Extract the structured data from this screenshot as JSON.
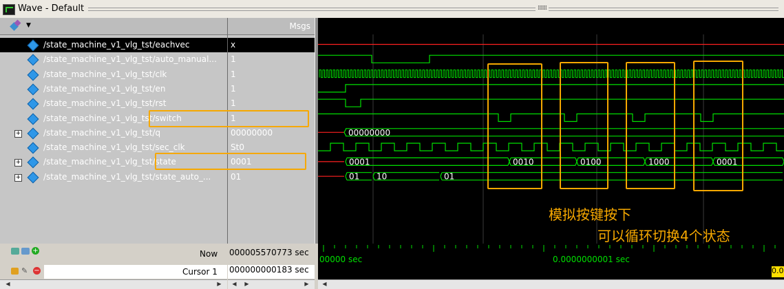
{
  "window": {
    "title": "Wave - Default"
  },
  "columns": {
    "msgs": "Msgs"
  },
  "signals": [
    {
      "name": "/state_machine_v1_vlg_tst/eachvec",
      "value": "x",
      "expandable": false
    },
    {
      "name": "/state_machine_v1_vlg_tst/auto_manual...",
      "value": "1",
      "expandable": false
    },
    {
      "name": "/state_machine_v1_vlg_tst/clk",
      "value": "1",
      "expandable": false
    },
    {
      "name": "/state_machine_v1_vlg_tst/en",
      "value": "1",
      "expandable": false
    },
    {
      "name": "/state_machine_v1_vlg_tst/rst",
      "value": "1",
      "expandable": false
    },
    {
      "name": "/state_machine_v1_vlg_tst/switch",
      "value": "1",
      "expandable": false
    },
    {
      "name": "/state_machine_v1_vlg_tst/q",
      "value": "00000000",
      "expandable": true
    },
    {
      "name": "/state_machine_v1_vlg_tst/sec_clk",
      "value": "St0",
      "expandable": false
    },
    {
      "name": "/state_machine_v1_vlg_tst/state",
      "value": "0001",
      "expandable": true
    },
    {
      "name": "/state_machine_v1_vlg_tst/state_auto_...",
      "value": "01",
      "expandable": true
    }
  ],
  "bus_labels": {
    "q": "00000000",
    "state": [
      "0001",
      "0010",
      "0100",
      "1000",
      "0001"
    ],
    "state_auto": [
      "01",
      "10",
      "01"
    ]
  },
  "status": {
    "now_label": "Now",
    "now_value": "000005570773 sec",
    "cursor_label": "Cursor 1",
    "cursor_value": "000000000183 sec",
    "timeline_left": "00000 sec",
    "timeline_mid": "0.0000000001 sec",
    "cursor_tag": "0.0"
  },
  "annotations": {
    "line1": "模拟按键按下",
    "line2": "可以循环切换4个状态"
  },
  "colors": {
    "wave_green": "#00e000",
    "cursor_yellow": "#ffe000",
    "annotation_orange": "#f6a800",
    "red_line": "#ff2020"
  },
  "icons": [
    "wave-window-icon",
    "signal-diamond-icon",
    "expand-plus-icon",
    "add-cursor-icon",
    "lock-icon",
    "delete-cursor-icon"
  ]
}
